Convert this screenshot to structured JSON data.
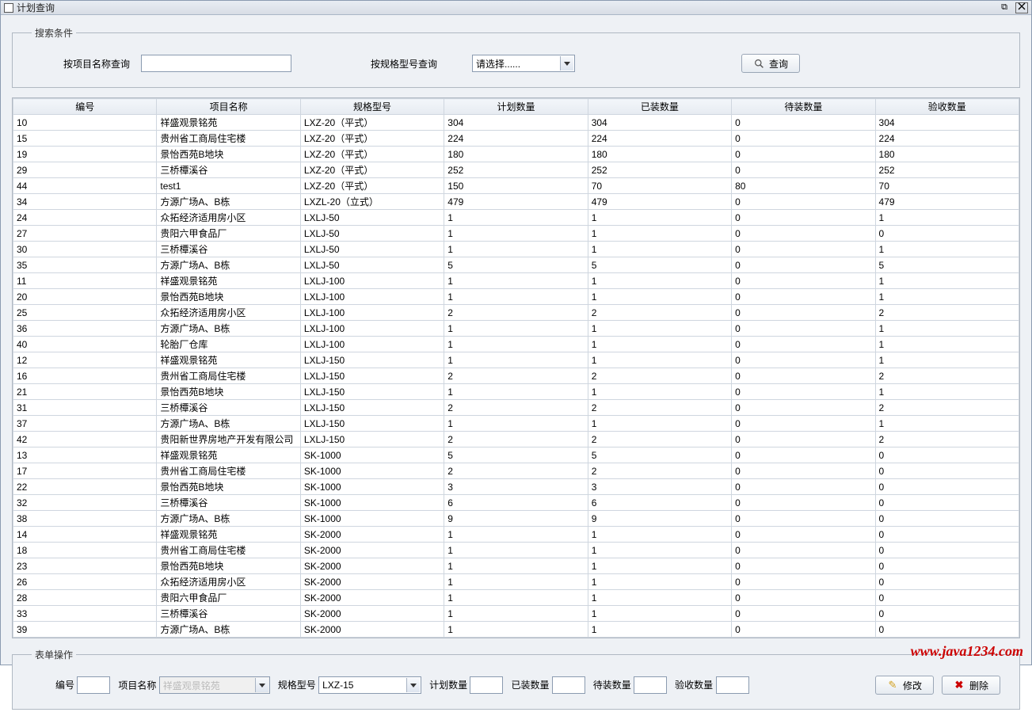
{
  "window": {
    "title": "计划查询"
  },
  "search": {
    "legend": "搜索条件",
    "byNameLabel": "按项目名称查询",
    "bySpecLabel": "按规格型号查询",
    "specPlaceholder": "请选择......",
    "queryBtn": "查询"
  },
  "table": {
    "headers": [
      "编号",
      "项目名称",
      "规格型号",
      "计划数量",
      "已装数量",
      "待装数量",
      "验收数量"
    ],
    "rows": [
      [
        "10",
        "祥盛观景铭苑",
        "LXZ-20（平式）",
        "304",
        "304",
        "0",
        "304"
      ],
      [
        "15",
        "贵州省工商局住宅楼",
        "LXZ-20（平式）",
        "224",
        "224",
        "0",
        "224"
      ],
      [
        "19",
        "景怡西苑B地块",
        "LXZ-20（平式）",
        "180",
        "180",
        "0",
        "180"
      ],
      [
        "29",
        "三桥橝溪谷",
        "LXZ-20（平式）",
        "252",
        "252",
        "0",
        "252"
      ],
      [
        "44",
        "test1",
        "LXZ-20（平式）",
        "150",
        "70",
        "80",
        "70"
      ],
      [
        "34",
        "方源广场A、B栋",
        "LXZL-20（立式）",
        "479",
        "479",
        "0",
        "479"
      ],
      [
        "24",
        "众拓经济适用房小区",
        "LXLJ-50",
        "1",
        "1",
        "0",
        "1"
      ],
      [
        "27",
        "贵阳六甲食品厂",
        "LXLJ-50",
        "1",
        "1",
        "0",
        "0"
      ],
      [
        "30",
        "三桥橝溪谷",
        "LXLJ-50",
        "1",
        "1",
        "0",
        "1"
      ],
      [
        "35",
        "方源广场A、B栋",
        "LXLJ-50",
        "5",
        "5",
        "0",
        "5"
      ],
      [
        "11",
        "祥盛观景铭苑",
        "LXLJ-100",
        "1",
        "1",
        "0",
        "1"
      ],
      [
        "20",
        "景怡西苑B地块",
        "LXLJ-100",
        "1",
        "1",
        "0",
        "1"
      ],
      [
        "25",
        "众拓经济适用房小区",
        "LXLJ-100",
        "2",
        "2",
        "0",
        "2"
      ],
      [
        "36",
        "方源广场A、B栋",
        "LXLJ-100",
        "1",
        "1",
        "0",
        "1"
      ],
      [
        "40",
        "轮胎厂仓库",
        "LXLJ-100",
        "1",
        "1",
        "0",
        "1"
      ],
      [
        "12",
        "祥盛观景铭苑",
        "LXLJ-150",
        "1",
        "1",
        "0",
        "1"
      ],
      [
        "16",
        "贵州省工商局住宅楼",
        "LXLJ-150",
        "2",
        "2",
        "0",
        "2"
      ],
      [
        "21",
        "景怡西苑B地块",
        "LXLJ-150",
        "1",
        "1",
        "0",
        "1"
      ],
      [
        "31",
        "三桥橝溪谷",
        "LXLJ-150",
        "2",
        "2",
        "0",
        "2"
      ],
      [
        "37",
        "方源广场A、B栋",
        "LXLJ-150",
        "1",
        "1",
        "0",
        "1"
      ],
      [
        "42",
        "贵阳新世界房地产开发有限公司",
        "LXLJ-150",
        "2",
        "2",
        "0",
        "2"
      ],
      [
        "13",
        "祥盛观景铭苑",
        "SK-1000",
        "5",
        "5",
        "0",
        "0"
      ],
      [
        "17",
        "贵州省工商局住宅楼",
        "SK-1000",
        "2",
        "2",
        "0",
        "0"
      ],
      [
        "22",
        "景怡西苑B地块",
        "SK-1000",
        "3",
        "3",
        "0",
        "0"
      ],
      [
        "32",
        "三桥橝溪谷",
        "SK-1000",
        "6",
        "6",
        "0",
        "0"
      ],
      [
        "38",
        "方源广场A、B栋",
        "SK-1000",
        "9",
        "9",
        "0",
        "0"
      ],
      [
        "14",
        "祥盛观景铭苑",
        "SK-2000",
        "1",
        "1",
        "0",
        "0"
      ],
      [
        "18",
        "贵州省工商局住宅楼",
        "SK-2000",
        "1",
        "1",
        "0",
        "0"
      ],
      [
        "23",
        "景怡西苑B地块",
        "SK-2000",
        "1",
        "1",
        "0",
        "0"
      ],
      [
        "26",
        "众拓经济适用房小区",
        "SK-2000",
        "1",
        "1",
        "0",
        "0"
      ],
      [
        "28",
        "贵阳六甲食品厂",
        "SK-2000",
        "1",
        "1",
        "0",
        "0"
      ],
      [
        "33",
        "三桥橝溪谷",
        "SK-2000",
        "1",
        "1",
        "0",
        "0"
      ],
      [
        "39",
        "方源广场A、B栋",
        "SK-2000",
        "1",
        "1",
        "0",
        "0"
      ]
    ]
  },
  "form": {
    "legend": "表单操作",
    "idLabel": "编号",
    "nameLabel": "项目名称",
    "namePlaceholder": "祥盛观景铭苑",
    "specLabel": "规格型号",
    "specValue": "LXZ-15",
    "planLabel": "计划数量",
    "installedLabel": "已装数量",
    "pendingLabel": "待装数量",
    "acceptLabel": "验收数量",
    "editBtn": "修改",
    "deleteBtn": "删除"
  },
  "footer": {
    "url": "www.java1234.com"
  }
}
